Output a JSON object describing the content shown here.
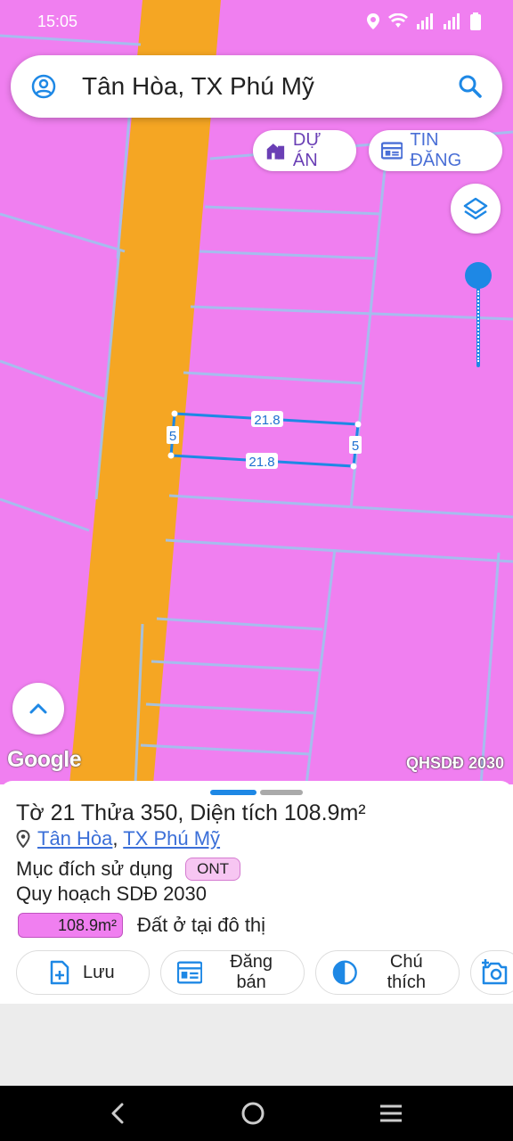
{
  "status_bar": {
    "time": "15:05"
  },
  "search": {
    "query": "Tân Hòa, TX Phú Mỹ"
  },
  "map_buttons": {
    "projects_label": "DỰ ÁN",
    "listings_label": "TIN ĐĂNG"
  },
  "map": {
    "google_label": "Google",
    "layer_label": "QHSDĐ 2030",
    "dimensions": {
      "top": "21.8",
      "bottom": "21.8",
      "left": "5",
      "right": "5"
    },
    "colors": {
      "residential": "#f07ff0",
      "road": "#f5a623",
      "parcel_line": "#8fb8e8",
      "selected_outline": "#1e88e5"
    }
  },
  "parcel": {
    "title": "Tờ 21 Thửa 350, Diện tích 108.9m²",
    "location_ward": "Tân Hòa",
    "location_sep": ",",
    "location_town": "TX Phú Mỹ",
    "purpose_label": "Mục đích sử dụng",
    "purpose_code": "ONT",
    "plan_label": "Quy hoạch SDĐ 2030",
    "area_value": "108.9m²",
    "land_type": "Đất ở tại đô thị"
  },
  "actions": {
    "save": "Lưu",
    "sell": "Đăng bán",
    "legend": "Chú thích"
  }
}
